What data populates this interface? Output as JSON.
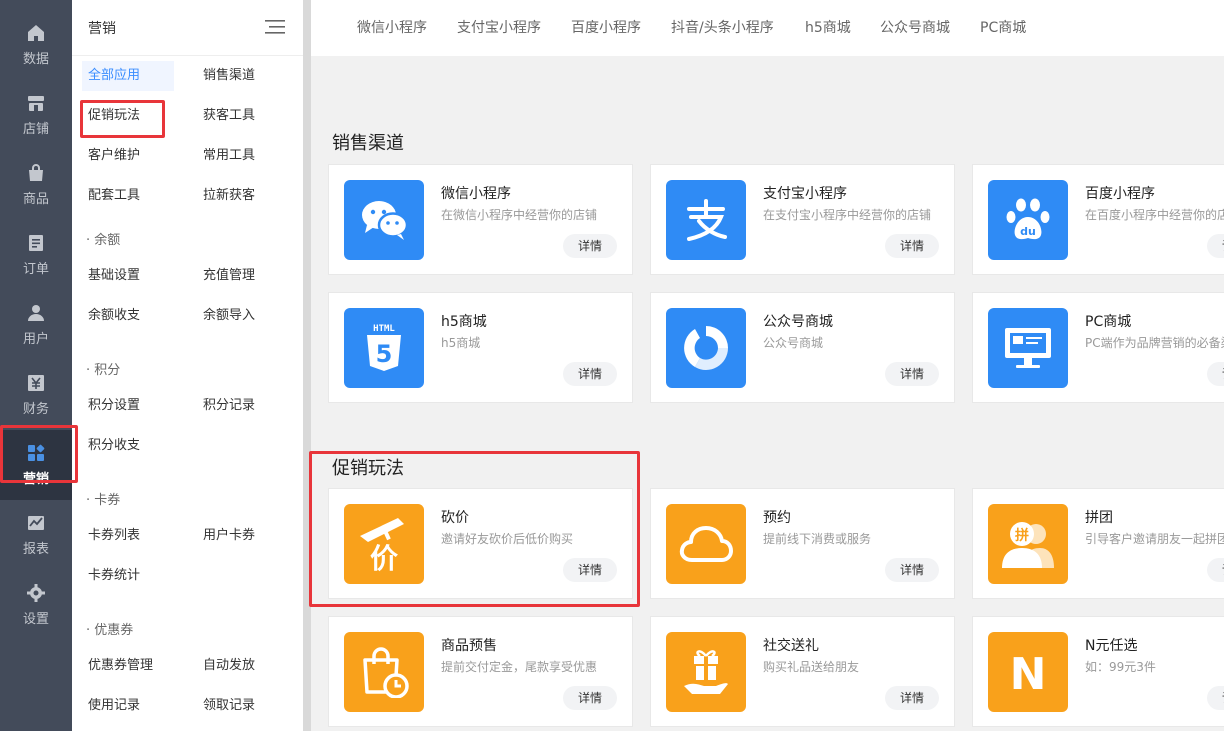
{
  "rail": {
    "items": [
      {
        "label": "数据",
        "icon": "home-icon"
      },
      {
        "label": "店铺",
        "icon": "store-icon"
      },
      {
        "label": "商品",
        "icon": "bag-icon"
      },
      {
        "label": "订单",
        "icon": "order-icon"
      },
      {
        "label": "用户",
        "icon": "user-icon"
      },
      {
        "label": "财务",
        "icon": "finance-icon"
      },
      {
        "label": "营销",
        "icon": "marketing-icon",
        "active": true
      },
      {
        "label": "报表",
        "icon": "chart-icon"
      },
      {
        "label": "设置",
        "icon": "gear-icon"
      }
    ]
  },
  "submenu": {
    "title": "营销",
    "items": {
      "all_apps": "全部应用",
      "sales_channel": "销售渠道",
      "promotion": "促销玩法",
      "acquire_tools": "获客工具",
      "customer_care": "客户维护",
      "common_tools": "常用工具",
      "support_tools": "配套工具",
      "new_customer": "拉新获客",
      "balance_group": "· 余额",
      "basic_settings": "基础设置",
      "recharge_manage": "充值管理",
      "balance_flow": "余额收支",
      "balance_import": "余额导入",
      "points_group": "· 积分",
      "points_settings": "积分设置",
      "points_records": "积分记录",
      "points_flow": "积分收支",
      "coupon_card_group": "· 卡券",
      "card_list": "卡券列表",
      "user_cards": "用户卡券",
      "card_stats": "卡券统计",
      "voucher_group": "· 优惠券",
      "voucher_manage": "优惠券管理",
      "auto_issue": "自动发放",
      "usage_records": "使用记录",
      "claim_records": "领取记录"
    }
  },
  "topnav": [
    "微信小程序",
    "支付宝小程序",
    "百度小程序",
    "抖音/头条小程序",
    "h5商城",
    "公众号商城",
    "PC商城"
  ],
  "sections": {
    "sales_channel": "销售渠道",
    "promotion": "促销玩法"
  },
  "detail_label": "详情",
  "cards": {
    "wechat": {
      "name": "微信小程序",
      "desc": "在微信小程序中经营你的店铺"
    },
    "alipay": {
      "name": "支付宝小程序",
      "desc": "在支付宝小程序中经营你的店铺"
    },
    "baidu": {
      "name": "百度小程序",
      "desc": "在百度小程序中经营你的店铺"
    },
    "h5": {
      "name": "h5商城",
      "desc": "h5商城"
    },
    "official": {
      "name": "公众号商城",
      "desc": "公众号商城"
    },
    "pc": {
      "name": "PC商城",
      "desc": "PC端作为品牌营销的必备渠道"
    },
    "bargain": {
      "name": "砍价",
      "desc": "邀请好友砍价后低价购买"
    },
    "reserve": {
      "name": "预约",
      "desc": "提前线下消费或服务"
    },
    "group": {
      "name": "拼团",
      "desc": "引导客户邀请朋友一起拼团"
    },
    "presale": {
      "name": "商品预售",
      "desc": "提前交付定金，尾款享受优惠"
    },
    "gift": {
      "name": "社交送礼",
      "desc": "购买礼品送给朋友"
    },
    "nchoice": {
      "name": "N元任选",
      "desc": "如：99元3件"
    }
  },
  "icon_text": {
    "html": "HTML",
    "html5": "5",
    "bargain_char": "价",
    "group_char": "拼",
    "n_char": "N"
  },
  "colors": {
    "blue": "#2f8bf5",
    "orange": "#f9a11b",
    "highlight": "#e8353a",
    "active_text": "#3a8dff"
  }
}
